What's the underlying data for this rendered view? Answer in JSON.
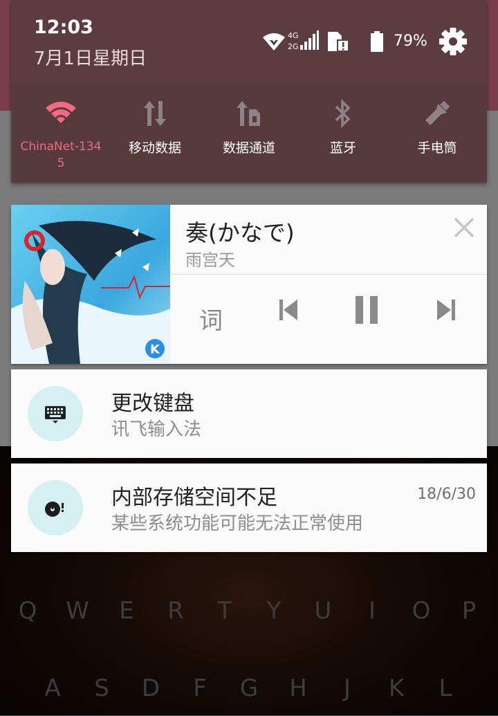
{
  "status_bar": {
    "time": "12:03",
    "date": "7月1日星期日",
    "network_label_top": "4G",
    "network_label_bottom": "2G",
    "battery_percent": "79%",
    "icons": [
      "wifi-icon",
      "signal-icon",
      "sim-alert-icon",
      "battery-icon",
      "gear-icon"
    ]
  },
  "quick_settings": {
    "accent_color": "#f06a80",
    "tiles": [
      {
        "label": "ChinaNet-134\n5",
        "icon": "wifi-icon",
        "active": true
      },
      {
        "label": "移动数据",
        "icon": "mobile-data-icon",
        "active": false
      },
      {
        "label": "数据通道",
        "icon": "data-channel-icon",
        "active": false
      },
      {
        "label": "蓝牙",
        "icon": "bluetooth-icon",
        "active": false
      },
      {
        "label": "手电筒",
        "icon": "flashlight-icon",
        "active": false
      }
    ]
  },
  "music": {
    "title": "奏(かなで)",
    "artist": "雨宫天",
    "lyric_button": "词",
    "controls": [
      "previous-icon",
      "pause-icon",
      "next-icon"
    ],
    "app_badge": "K"
  },
  "notifications": [
    {
      "title": "更改键盘",
      "text": "讯飞输入法",
      "time": "",
      "icon": "keyboard-icon"
    },
    {
      "title": "内部存储空间不足",
      "text": "某些系统功能可能无法正常使用",
      "time": "18/6/30",
      "icon": "storage-alert-icon"
    }
  ],
  "keyboard": {
    "row1": [
      "Q",
      "W",
      "E",
      "R",
      "T",
      "Y",
      "U",
      "I",
      "O",
      "P"
    ],
    "row2": [
      "A",
      "S",
      "D",
      "F",
      "G",
      "H",
      "J",
      "K",
      "L"
    ]
  }
}
